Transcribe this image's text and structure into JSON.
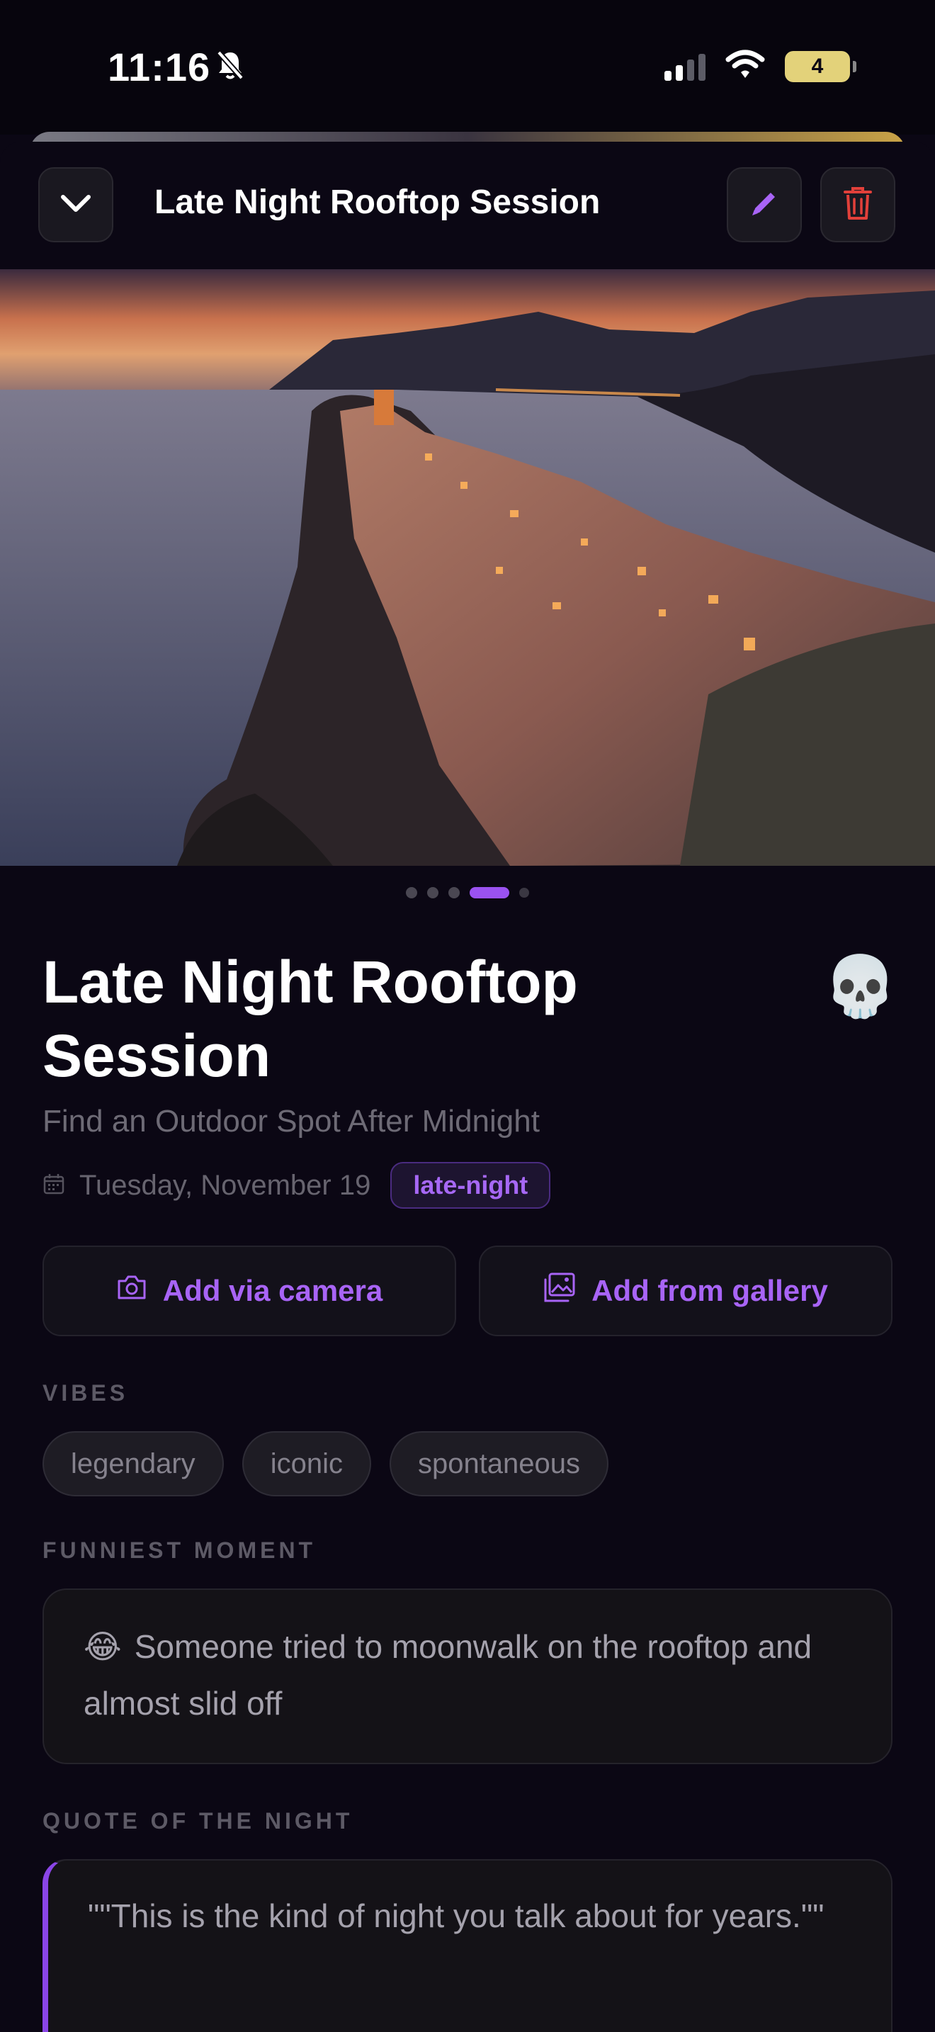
{
  "status_bar": {
    "time": "11:16",
    "battery": "4"
  },
  "header": {
    "title": "Late Night Rooftop Session"
  },
  "carousel": {
    "dot_count": 5,
    "active_index": 3
  },
  "event": {
    "title": "Late Night Rooftop Session",
    "emoji": "💀",
    "subtitle": "Find an Outdoor Spot After Midnight",
    "date": "Tuesday, November 19",
    "tag": "late-night"
  },
  "actions": {
    "camera_label": "Add via camera",
    "gallery_label": "Add from gallery"
  },
  "vibes": {
    "label": "VIBES",
    "items": [
      "legendary",
      "iconic",
      "spontaneous"
    ]
  },
  "funniest": {
    "label": "FUNNIEST MOMENT",
    "emoji": "😂",
    "text": "Someone tried to moonwalk on the rooftop and almost slid off"
  },
  "quote": {
    "label": "QUOTE OF THE NIGHT",
    "text": "\"\"This is the kind of night you talk about for years.\"\""
  },
  "colors": {
    "background": "#0b0714",
    "accent": "#a864f6",
    "delete": "#e2403a"
  }
}
